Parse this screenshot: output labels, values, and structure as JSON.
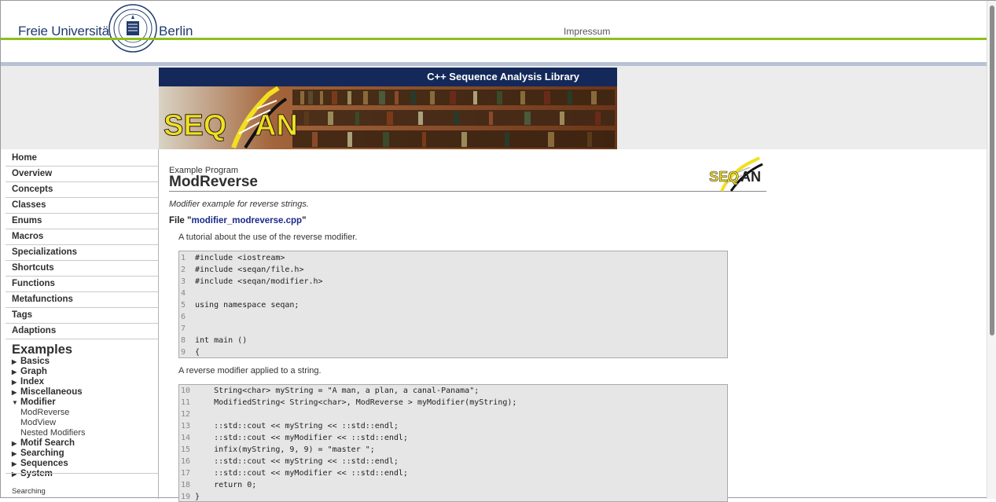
{
  "header": {
    "university_left": "Freie Universität",
    "university_right": "Berlin",
    "impressum": "Impressum"
  },
  "banner": {
    "title": "C++ Sequence Analysis Library",
    "logo_text": "SEQAN"
  },
  "sidebar": {
    "nav": [
      "Home",
      "Overview",
      "Concepts",
      "Classes",
      "Enums",
      "Macros",
      "Specializations",
      "Shortcuts",
      "Functions",
      "Metafunctions",
      "Tags",
      "Adaptions"
    ],
    "examples_heading": "Examples",
    "examples": [
      {
        "label": "Basics",
        "expanded": false
      },
      {
        "label": "Graph",
        "expanded": false
      },
      {
        "label": "Index",
        "expanded": false
      },
      {
        "label": "Miscellaneous",
        "expanded": false
      },
      {
        "label": "Modifier",
        "expanded": true,
        "children": [
          "ModReverse",
          "ModView",
          "Nested Modifiers"
        ]
      },
      {
        "label": "Motif Search",
        "expanded": false
      },
      {
        "label": "Searching",
        "expanded": false
      },
      {
        "label": "Sequences",
        "expanded": false
      },
      {
        "label": "System",
        "expanded": false
      }
    ],
    "footer": "Searching"
  },
  "main": {
    "example_label": "Example Program",
    "title": "ModReverse",
    "summary": "Modifier example for reverse strings.",
    "file_prefix": "File \"",
    "file_name": "modifier_modreverse.cpp",
    "file_suffix": "\"",
    "para1": "A tutorial about the use of the reverse modifier.",
    "code1": [
      {
        "n": "1",
        "t": "#include <iostream>"
      },
      {
        "n": "2",
        "t": "#include <seqan/file.h>"
      },
      {
        "n": "3",
        "t": "#include <seqan/modifier.h>"
      },
      {
        "n": "4",
        "t": ""
      },
      {
        "n": "5",
        "t": "using namespace seqan;"
      },
      {
        "n": "6",
        "t": ""
      },
      {
        "n": "7",
        "t": ""
      },
      {
        "n": "8",
        "t": "int main ()"
      },
      {
        "n": "9",
        "t": "{"
      }
    ],
    "para2": "A reverse modifier applied to a string.",
    "code2": [
      {
        "n": "10",
        "t": "    String<char> myString = \"A man, a plan, a canal-Panama\";"
      },
      {
        "n": "11",
        "t": "    ModifiedString< String<char>, ModReverse > myModifier(myString);"
      },
      {
        "n": "12",
        "t": ""
      },
      {
        "n": "13",
        "t": "    ::std::cout << myString << ::std::endl;"
      },
      {
        "n": "14",
        "t": "    ::std::cout << myModifier << ::std::endl;"
      },
      {
        "n": "15",
        "t": "    infix(myString, 9, 9) = \"master \";"
      },
      {
        "n": "16",
        "t": "    ::std::cout << myString << ::std::endl;"
      },
      {
        "n": "17",
        "t": "    ::std::cout << myModifier << ::std::endl;"
      },
      {
        "n": "18",
        "t": "    return 0;"
      },
      {
        "n": "19",
        "t": "}"
      }
    ]
  }
}
